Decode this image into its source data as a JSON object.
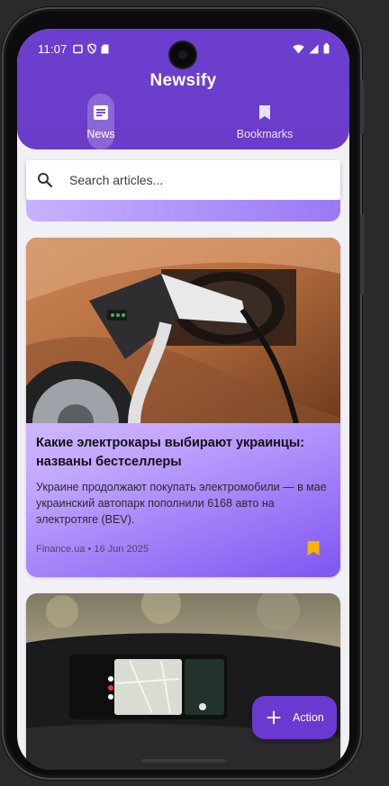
{
  "status_bar": {
    "time": "11:07"
  },
  "app": {
    "title": "Newsify"
  },
  "tabs": [
    {
      "label": "News",
      "icon": "article-icon",
      "selected": true
    },
    {
      "label": "Bookmarks",
      "icon": "bookmark-icon",
      "selected": false
    }
  ],
  "search": {
    "placeholder": "Search articles..."
  },
  "articles": [
    {
      "title": "Какие электрокары выбирают украинцы: названы бестселлеры",
      "description": "Украине продолжают покупать электромобили — в мае украинский автопарк пополнили 6168 авто на электротяге (BEV).",
      "meta": "Finance.ua • 16 Jun 2025",
      "bookmarked": true,
      "image": "ev-charging-photo"
    },
    {
      "image": "car-dashboard-photo"
    }
  ],
  "fab": {
    "label": "Action",
    "icon": "plus-icon"
  },
  "colors": {
    "primary": "#6a3cc8",
    "bookmark": "#f5b400",
    "background": "#f1f0f5"
  }
}
